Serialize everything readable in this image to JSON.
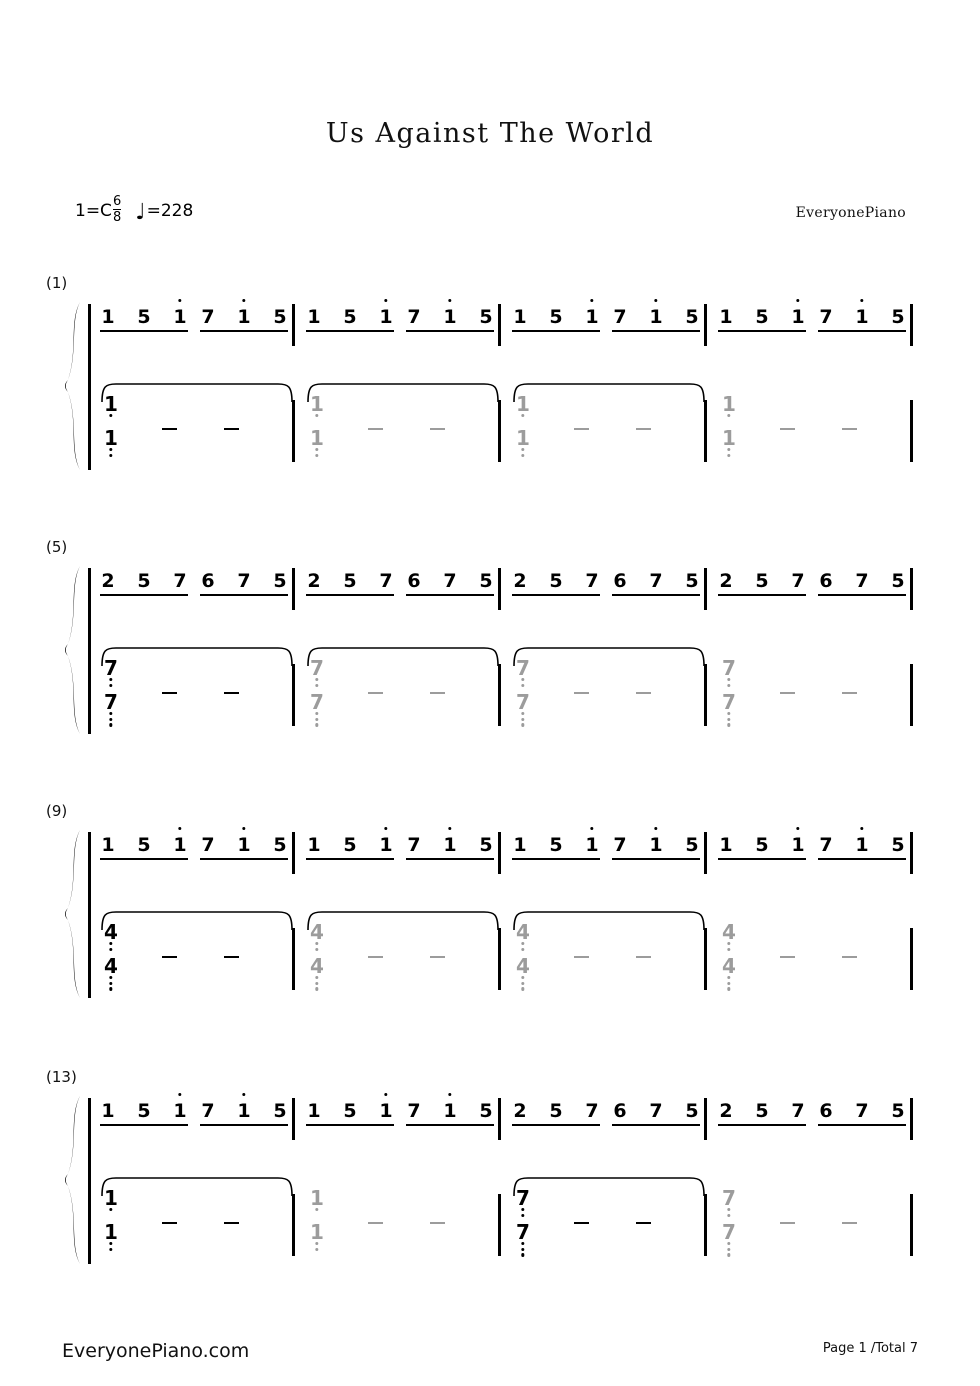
{
  "page": {
    "title": "Us Against The World",
    "key_signature": "1=C",
    "time_signature_numerator": "6",
    "time_signature_denominator": "8",
    "tempo_equals": "=228",
    "tempo_note_glyph": "quarter-note",
    "credit": "EveryonePiano",
    "footer_left": "EveryonePiano.com",
    "footer_right": "Page 1 /Total 7",
    "colors": {
      "ink": "#000000",
      "grey_note": "#9c9c9c",
      "background": "#ffffff"
    }
  },
  "systems": [
    {
      "label": "(1)",
      "measures": [
        {
          "number": 1,
          "treble_groups": [
            [
              "1",
              "5",
              "1."
            ],
            [
              "7",
              "1.",
              "5"
            ]
          ],
          "bass": {
            "upper": "1",
            "upper_low_dots": 1,
            "lower": "1",
            "lower_low_dots": 2,
            "grey": false
          },
          "dashes": 2,
          "slur_start": true
        },
        {
          "number": 2,
          "treble_groups": [
            [
              "1",
              "5",
              "1."
            ],
            [
              "7",
              "1.",
              "5"
            ]
          ],
          "bass": {
            "upper": "1",
            "upper_low_dots": 1,
            "lower": "1",
            "lower_low_dots": 2,
            "grey": true
          },
          "dashes": 2,
          "slur_start": true
        },
        {
          "number": 3,
          "treble_groups": [
            [
              "1",
              "5",
              "1."
            ],
            [
              "7",
              "1.",
              "5"
            ]
          ],
          "bass": {
            "upper": "1",
            "upper_low_dots": 1,
            "lower": "1",
            "lower_low_dots": 2,
            "grey": true
          },
          "dashes": 2,
          "slur_start": true
        },
        {
          "number": 4,
          "treble_groups": [
            [
              "1",
              "5",
              "1."
            ],
            [
              "7",
              "1.",
              "5"
            ]
          ],
          "bass": {
            "upper": "1",
            "upper_low_dots": 1,
            "lower": "1",
            "lower_low_dots": 2,
            "grey": true
          },
          "dashes": 2,
          "slur_start": false
        }
      ]
    },
    {
      "label": "(5)",
      "measures": [
        {
          "number": 5,
          "treble_groups": [
            [
              "2",
              "5",
              "7"
            ],
            [
              "6",
              "7",
              "5"
            ]
          ],
          "bass": {
            "upper": "7",
            "upper_low_dots": 2,
            "lower": "7",
            "lower_low_dots": 3,
            "grey": false
          },
          "dashes": 2,
          "slur_start": true
        },
        {
          "number": 6,
          "treble_groups": [
            [
              "2",
              "5",
              "7"
            ],
            [
              "6",
              "7",
              "5"
            ]
          ],
          "bass": {
            "upper": "7",
            "upper_low_dots": 2,
            "lower": "7",
            "lower_low_dots": 3,
            "grey": true
          },
          "dashes": 2,
          "slur_start": true
        },
        {
          "number": 7,
          "treble_groups": [
            [
              "2",
              "5",
              "7"
            ],
            [
              "6",
              "7",
              "5"
            ]
          ],
          "bass": {
            "upper": "7",
            "upper_low_dots": 2,
            "lower": "7",
            "lower_low_dots": 3,
            "grey": true
          },
          "dashes": 2,
          "slur_start": true
        },
        {
          "number": 8,
          "treble_groups": [
            [
              "2",
              "5",
              "7"
            ],
            [
              "6",
              "7",
              "5"
            ]
          ],
          "bass": {
            "upper": "7",
            "upper_low_dots": 2,
            "lower": "7",
            "lower_low_dots": 3,
            "grey": true
          },
          "dashes": 2,
          "slur_start": false
        }
      ]
    },
    {
      "label": "(9)",
      "measures": [
        {
          "number": 9,
          "treble_groups": [
            [
              "1",
              "5",
              "1."
            ],
            [
              "7",
              "1.",
              "5"
            ]
          ],
          "bass": {
            "upper": "4",
            "upper_low_dots": 2,
            "lower": "4",
            "lower_low_dots": 3,
            "grey": false
          },
          "dashes": 2,
          "slur_start": true
        },
        {
          "number": 10,
          "treble_groups": [
            [
              "1",
              "5",
              "1."
            ],
            [
              "7",
              "1.",
              "5"
            ]
          ],
          "bass": {
            "upper": "4",
            "upper_low_dots": 2,
            "lower": "4",
            "lower_low_dots": 3,
            "grey": true
          },
          "dashes": 2,
          "slur_start": true
        },
        {
          "number": 11,
          "treble_groups": [
            [
              "1",
              "5",
              "1."
            ],
            [
              "7",
              "1.",
              "5"
            ]
          ],
          "bass": {
            "upper": "4",
            "upper_low_dots": 2,
            "lower": "4",
            "lower_low_dots": 3,
            "grey": true
          },
          "dashes": 2,
          "slur_start": true
        },
        {
          "number": 12,
          "treble_groups": [
            [
              "1",
              "5",
              "1."
            ],
            [
              "7",
              "1.",
              "5"
            ]
          ],
          "bass": {
            "upper": "4",
            "upper_low_dots": 2,
            "lower": "4",
            "lower_low_dots": 3,
            "grey": true
          },
          "dashes": 2,
          "slur_start": false
        }
      ]
    },
    {
      "label": "(13)",
      "measures": [
        {
          "number": 13,
          "treble_groups": [
            [
              "1",
              "5",
              "1."
            ],
            [
              "7",
              "1.",
              "5"
            ]
          ],
          "bass": {
            "upper": "1",
            "upper_low_dots": 1,
            "lower": "1",
            "lower_low_dots": 2,
            "grey": false
          },
          "dashes": 2,
          "slur_start": true
        },
        {
          "number": 14,
          "treble_groups": [
            [
              "1",
              "5",
              "1."
            ],
            [
              "7",
              "1.",
              "5"
            ]
          ],
          "bass": {
            "upper": "1",
            "upper_low_dots": 1,
            "lower": "1",
            "lower_low_dots": 2,
            "grey": true
          },
          "dashes": 2,
          "slur_start": false
        },
        {
          "number": 15,
          "treble_groups": [
            [
              "2",
              "5",
              "7"
            ],
            [
              "6",
              "7",
              "5"
            ]
          ],
          "bass": {
            "upper": "7",
            "upper_low_dots": 2,
            "lower": "7",
            "lower_low_dots": 3,
            "grey": false
          },
          "dashes": 2,
          "slur_start": true
        },
        {
          "number": 16,
          "treble_groups": [
            [
              "2",
              "5",
              "7"
            ],
            [
              "6",
              "7",
              "5"
            ]
          ],
          "bass": {
            "upper": "7",
            "upper_low_dots": 2,
            "lower": "7",
            "lower_low_dots": 3,
            "grey": true
          },
          "dashes": 2,
          "slur_start": false
        }
      ]
    }
  ]
}
